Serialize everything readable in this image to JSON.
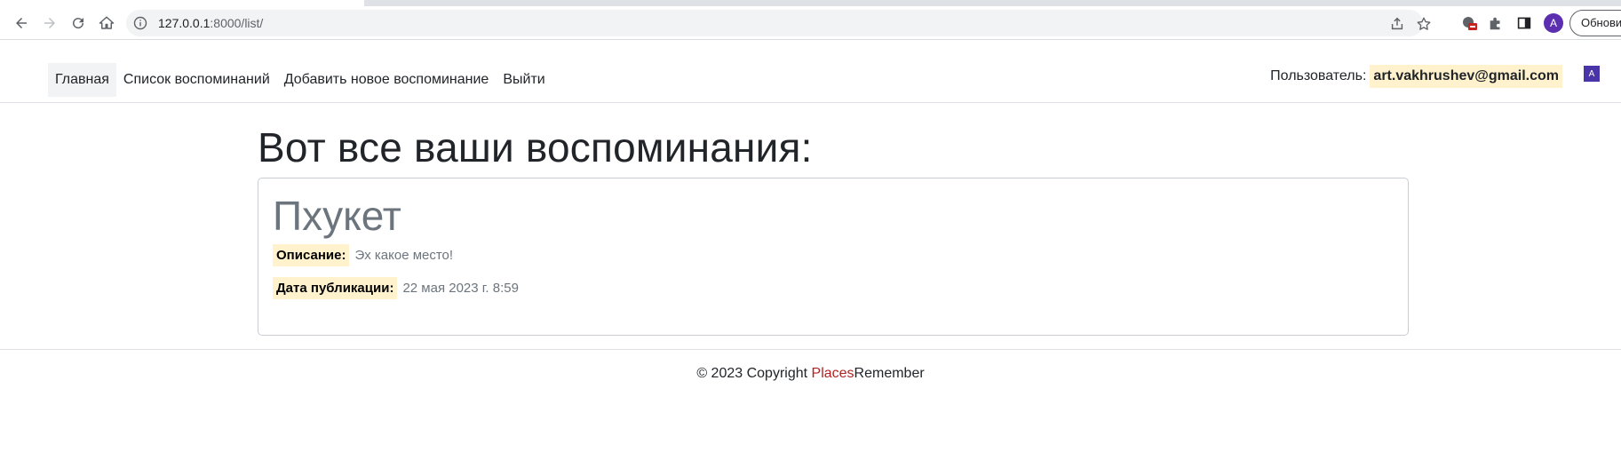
{
  "browser": {
    "url_host": "127.0.0.1",
    "url_rest": ":8000/list/",
    "update_label": "Обновить",
    "profile_initial": "A"
  },
  "nav": {
    "links": [
      {
        "label": "Главная",
        "active": true
      },
      {
        "label": "Список воспоминаний"
      },
      {
        "label": "Добавить новое воспоминание"
      },
      {
        "label": "Выйти"
      }
    ],
    "user_label": "Пользователь:",
    "user_email": "art.vakhrushev@gmail.com",
    "avatar_initial": "A"
  },
  "main": {
    "heading": "Вот все ваши воспоминания:",
    "memories": [
      {
        "title": "Пхукет",
        "description_label": "Описание:",
        "description": "Эх какое место!",
        "date_label": "Дата публикации:",
        "date": "22 мая 2023 г. 8:59"
      }
    ]
  },
  "footer": {
    "copyright": "© 2023 Copyright ",
    "brand_part1": "Places",
    "brand_part2": "Remember"
  },
  "colors": {
    "accent_brand": "#b22222",
    "label_highlight": "#fff2cc",
    "avatar": "#4a35a8"
  }
}
